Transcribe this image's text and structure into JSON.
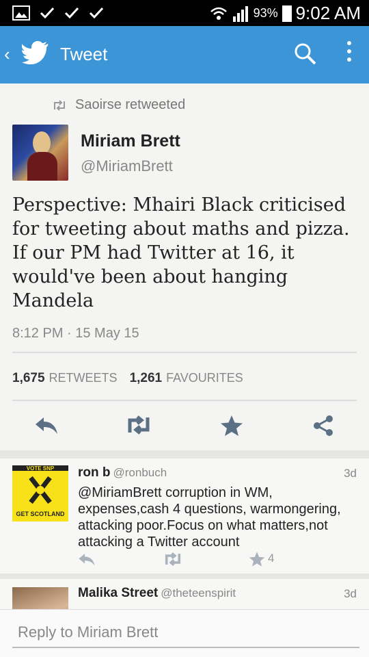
{
  "status_bar": {
    "battery_pct": "93%",
    "time": "9:02 AM"
  },
  "app_bar": {
    "title": "Tweet",
    "colors": {
      "accent": "#3b95d6"
    }
  },
  "tweet": {
    "retweeted_by": "Saoirse retweeted",
    "author_name": "Miriam Brett",
    "author_handle": "@MiriamBrett",
    "text": "Perspective: Mhairi Black criticised for tweeting about maths and pizza. If our PM had Twitter at 16, it would've been about hanging Mandela",
    "timestamp": "8:12 PM · 15 May 15",
    "retweets_count": "1,675",
    "retweets_label": "RETWEETS",
    "favourites_count": "1,261",
    "favourites_label": "FAVOURITES"
  },
  "replies": [
    {
      "name": "ron b",
      "handle": "@ronbuch",
      "time": "3d",
      "text": "@MiriamBrett corruption in WM, expenses,cash 4 questions, warmongering, attacking poor.Focus on what matters,not attacking a Twitter account",
      "favourites": "4",
      "avatar_top_text": "VOTE SNP",
      "avatar_bottom_text": "GET SCOTLAND"
    },
    {
      "name": "Malika Street",
      "handle": "@theteenspirit",
      "time": "3d"
    }
  ],
  "reply_bar": {
    "placeholder": "Reply to Miriam Brett"
  }
}
